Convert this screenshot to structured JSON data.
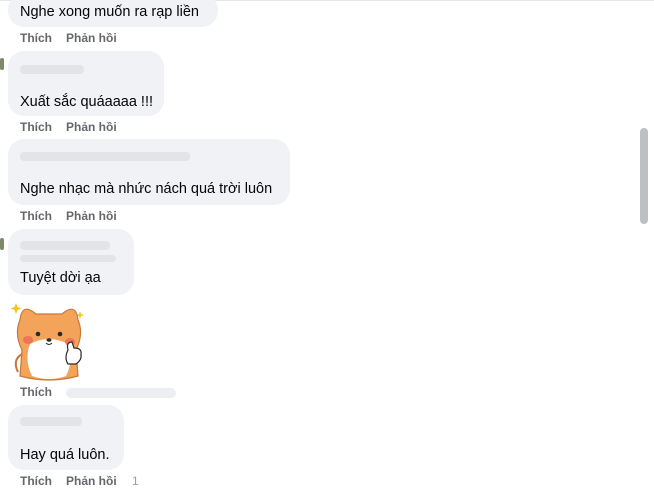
{
  "comments": [
    {
      "text": "Nghe xong muốn ra rạp liền",
      "like": "Thích",
      "reply": "Phản hồi",
      "time": ""
    },
    {
      "text": "Xuất sắc quáaaaa !!!",
      "like": "Thích",
      "reply": "Phản hồi",
      "time": ""
    },
    {
      "text": "Nghe nhạc mà nhức nách quá trời luôn",
      "like": "Thích",
      "reply": "Phản hồi",
      "time": ""
    },
    {
      "text": "Tuyệt dời ạa",
      "like": "Thích",
      "reply": "Phản hồi",
      "time": ""
    },
    {
      "text": "",
      "like": "Thích",
      "reply": "",
      "time": "",
      "sticker": "shiba-thumbs-up-sticker"
    },
    {
      "text": "Hay quá luôn.",
      "like": "Thích",
      "reply": "Phản hồi",
      "time": "1"
    }
  ],
  "colors": {
    "bubble": "#f0f2f5",
    "action_text": "#65676b",
    "scrollbar": "#bcc0c4"
  }
}
